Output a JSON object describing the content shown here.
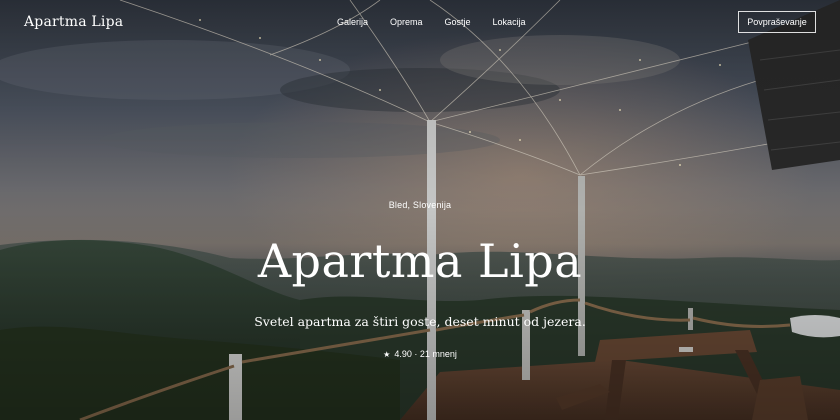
{
  "header": {
    "brand": "Apartma Lipa",
    "nav": [
      "Galerija",
      "Oprema",
      "Gostje",
      "Lokacija"
    ],
    "cta": "Povpraševanje"
  },
  "hero": {
    "location": "Bled, Slovenija",
    "title": "Apartma Lipa",
    "tagline": "Svetel apartma za štiri goste, deset minut od jezera.",
    "rating": "4.90 · 21 mnenj",
    "rating_icon": "star-icon",
    "image_subject": "terrace at dusk with string lights and picnic table overlooking hills"
  },
  "colors": {
    "text": "#ffffff",
    "border": "#ffffff"
  }
}
